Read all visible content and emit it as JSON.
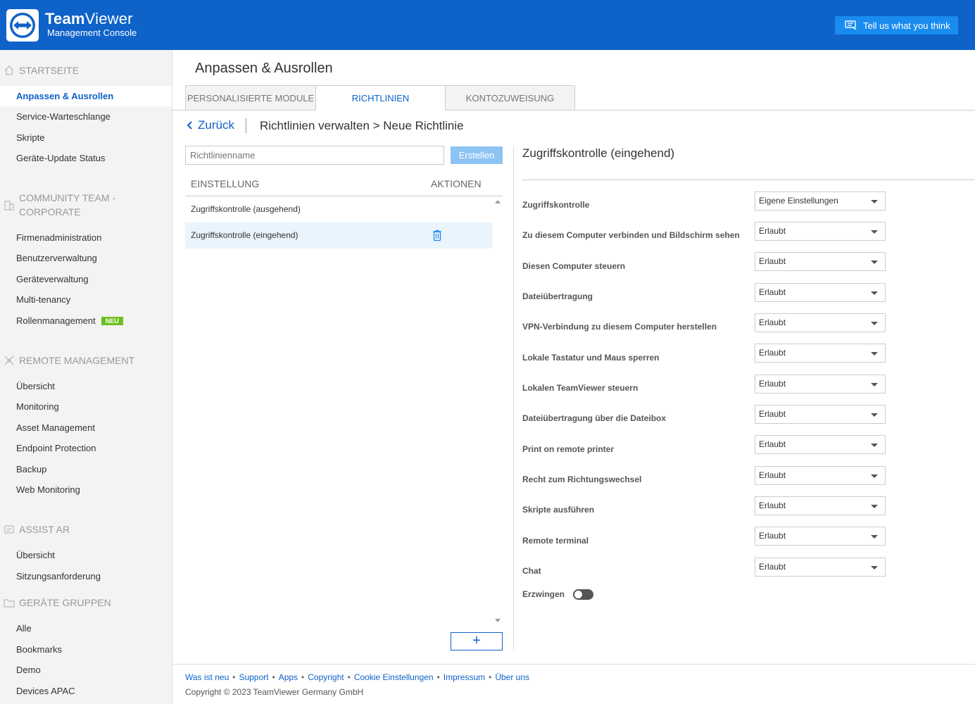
{
  "header": {
    "brand_bold": "Team",
    "brand_rest": "Viewer",
    "brand_sub": "Management Console",
    "feedback_label": "Tell us what you think"
  },
  "sidebar": {
    "sections": [
      {
        "title": "STARTSEITE"
      },
      {
        "title": "COMMUNITY TEAM - CORPORATE"
      },
      {
        "title": "REMOTE MANAGEMENT"
      },
      {
        "title": "ASSIST AR"
      },
      {
        "title": "GERÄTE GRUPPEN"
      }
    ],
    "items": [
      {
        "label": "Anpassen & Ausrollen"
      },
      {
        "label": "Service-Warteschlange"
      },
      {
        "label": "Skripte"
      },
      {
        "label": "Geräte-Update Status"
      },
      {
        "label": "Firmenadministration"
      },
      {
        "label": "Benutzerverwaltung"
      },
      {
        "label": "Geräteverwaltung"
      },
      {
        "label": "Multi-tenancy"
      },
      {
        "label": "Rollenmanagement",
        "badge": "NEU"
      },
      {
        "label": "Übersicht"
      },
      {
        "label": "Monitoring"
      },
      {
        "label": "Asset Management"
      },
      {
        "label": "Endpoint Protection"
      },
      {
        "label": "Backup"
      },
      {
        "label": "Web Monitoring"
      },
      {
        "label": "Übersicht"
      },
      {
        "label": "Sitzungsanforderung"
      },
      {
        "label": "Alle"
      },
      {
        "label": "Bookmarks"
      },
      {
        "label": "Demo"
      },
      {
        "label": "Devices APAC"
      }
    ]
  },
  "main": {
    "title": "Anpassen & Ausrollen",
    "tabs": [
      {
        "label": "PERSONALISIERTE MODULE"
      },
      {
        "label": "RICHTLINIEN"
      },
      {
        "label": "KONTOZUWEISUNG"
      }
    ],
    "back_label": "Zurück",
    "breadcrumb": "Richtlinien verwalten > Neue Richtlinie",
    "name_placeholder": "Richtlinienname",
    "create_label": "Erstellen",
    "col_setting": "EINSTELLUNG",
    "col_actions": "AKTIONEN",
    "list": [
      {
        "label": "Zugriffskontrolle (ausgehend)"
      },
      {
        "label": "Zugriffskontrolle (eingehend)"
      }
    ],
    "add_label": "+"
  },
  "panel": {
    "title": "Zugriffskontrolle (eingehend)",
    "settings": [
      {
        "label": "Zugriffskontrolle",
        "value": "Eigene Einstellungen"
      },
      {
        "label": "Zu diesem Computer verbinden und Bildschirm sehen",
        "value": "Erlaubt"
      },
      {
        "label": "Diesen Computer steuern",
        "value": "Erlaubt"
      },
      {
        "label": "Dateiübertragung",
        "value": "Erlaubt"
      },
      {
        "label": "VPN-Verbindung zu diesem Computer herstellen",
        "value": "Erlaubt"
      },
      {
        "label": "Lokale Tastatur und Maus sperren",
        "value": "Erlaubt"
      },
      {
        "label": "Lokalen TeamViewer steuern",
        "value": "Erlaubt"
      },
      {
        "label": "Dateiübertragung über die Dateibox",
        "value": "Erlaubt"
      },
      {
        "label": "Print on remote printer",
        "value": "Erlaubt"
      },
      {
        "label": "Recht zum Richtungswechsel",
        "value": "Erlaubt"
      },
      {
        "label": "Skripte ausführen",
        "value": "Erlaubt"
      },
      {
        "label": "Remote terminal",
        "value": "Erlaubt"
      },
      {
        "label": "Chat",
        "value": "Erlaubt"
      }
    ],
    "enforce_label": "Erzwingen",
    "enforce_on": false
  },
  "footer": {
    "links": [
      "Was ist neu",
      "Support",
      "Apps",
      "Copyright",
      "Cookie Einstellungen",
      "Impressum",
      "Über uns"
    ],
    "copyright": "Copyright © 2023 TeamViewer Germany GmbH"
  }
}
